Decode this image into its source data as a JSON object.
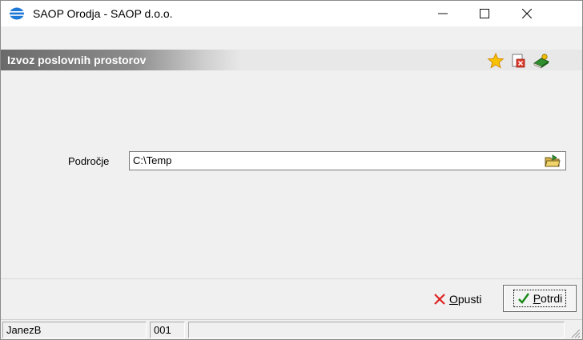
{
  "window": {
    "title": "SAOP Orodja - SAOP d.o.o.",
    "controls": {
      "minimize": "—",
      "maximize": "☐",
      "close": "✕"
    }
  },
  "header": {
    "title": "Izvoz poslovnih prostorov",
    "icons": [
      "star-icon",
      "close-document-icon",
      "help-book-icon"
    ]
  },
  "form": {
    "field_label": "Področje",
    "path_value": "C:\\Temp"
  },
  "buttons": {
    "cancel_label": "Opusti",
    "cancel_mnemonic": "O",
    "cancel_rest": "pusti",
    "confirm_label": "Potrdi",
    "confirm_mnemonic": "P",
    "confirm_rest": "otrdi"
  },
  "status": {
    "user": "JanezB",
    "code": "001",
    "extra": ""
  },
  "colors": {
    "header_band_dark": "#6a6a6a",
    "cancel_x": "#e02020",
    "confirm_check": "#1a8a1a",
    "star": "#f2b200"
  }
}
